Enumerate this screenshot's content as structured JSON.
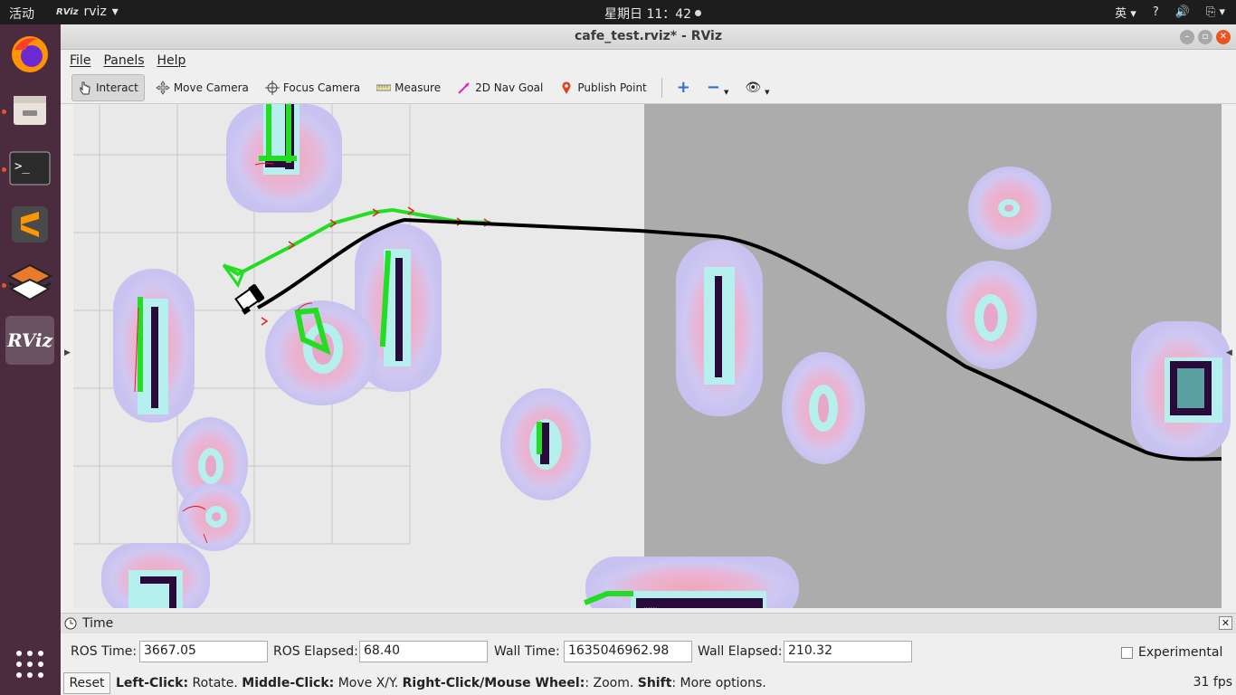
{
  "topbar": {
    "activities": "活动",
    "app_name": "rviz",
    "app_icon_text": "RViz",
    "clock": "星期日 11：42",
    "input_method": "英",
    "help": "?"
  },
  "dock": {
    "items": [
      {
        "name": "firefox",
        "icon": "firefox-icon"
      },
      {
        "name": "files",
        "icon": "files-icon"
      },
      {
        "name": "terminal",
        "icon": "terminal-icon"
      },
      {
        "name": "sublime-text",
        "icon": "sublime-icon"
      },
      {
        "name": "layers-app",
        "icon": "layers-icon"
      },
      {
        "name": "rviz",
        "icon": "rviz-icon",
        "label": "RViz"
      },
      {
        "name": "show-applications",
        "icon": "grid-icon"
      }
    ]
  },
  "window": {
    "title": "cafe_test.rviz* - RViz"
  },
  "menu": {
    "file": "File",
    "panels": "Panels",
    "help": "Help"
  },
  "toolbar": {
    "interact": "Interact",
    "move_camera": "Move Camera",
    "focus_camera": "Focus Camera",
    "measure": "Measure",
    "nav_goal": "2D Nav Goal",
    "publish_point": "Publish Point"
  },
  "time_panel": {
    "title": "Time",
    "ros_time_label": "ROS Time:",
    "ros_time": "3667.05",
    "ros_elapsed_label": "ROS Elapsed:",
    "ros_elapsed": "68.40",
    "wall_time_label": "Wall Time:",
    "wall_time": "1635046962.98",
    "wall_elapsed_label": "Wall Elapsed:",
    "wall_elapsed": "210.32",
    "experimental": "Experimental"
  },
  "status": {
    "reset": "Reset",
    "hint_left_click": "Left-Click:",
    "hint_rotate": " Rotate. ",
    "hint_middle_click": "Middle-Click:",
    "hint_move": " Move X/Y. ",
    "hint_right_click": "Right-Click/Mouse Wheel:",
    "hint_zoom": ": Zoom. ",
    "hint_shift": "Shift",
    "hint_more": ": More options.",
    "fps": "31 fps"
  },
  "colors": {
    "dock_bg": "#4b2c3f",
    "accent": "#e95420",
    "plan_green": "#22dd22",
    "path_black": "#000000",
    "costmap_halo": "#c8c3f0",
    "costmap_core": "#a8f0ec",
    "obstacle": "#2a0a3a"
  }
}
